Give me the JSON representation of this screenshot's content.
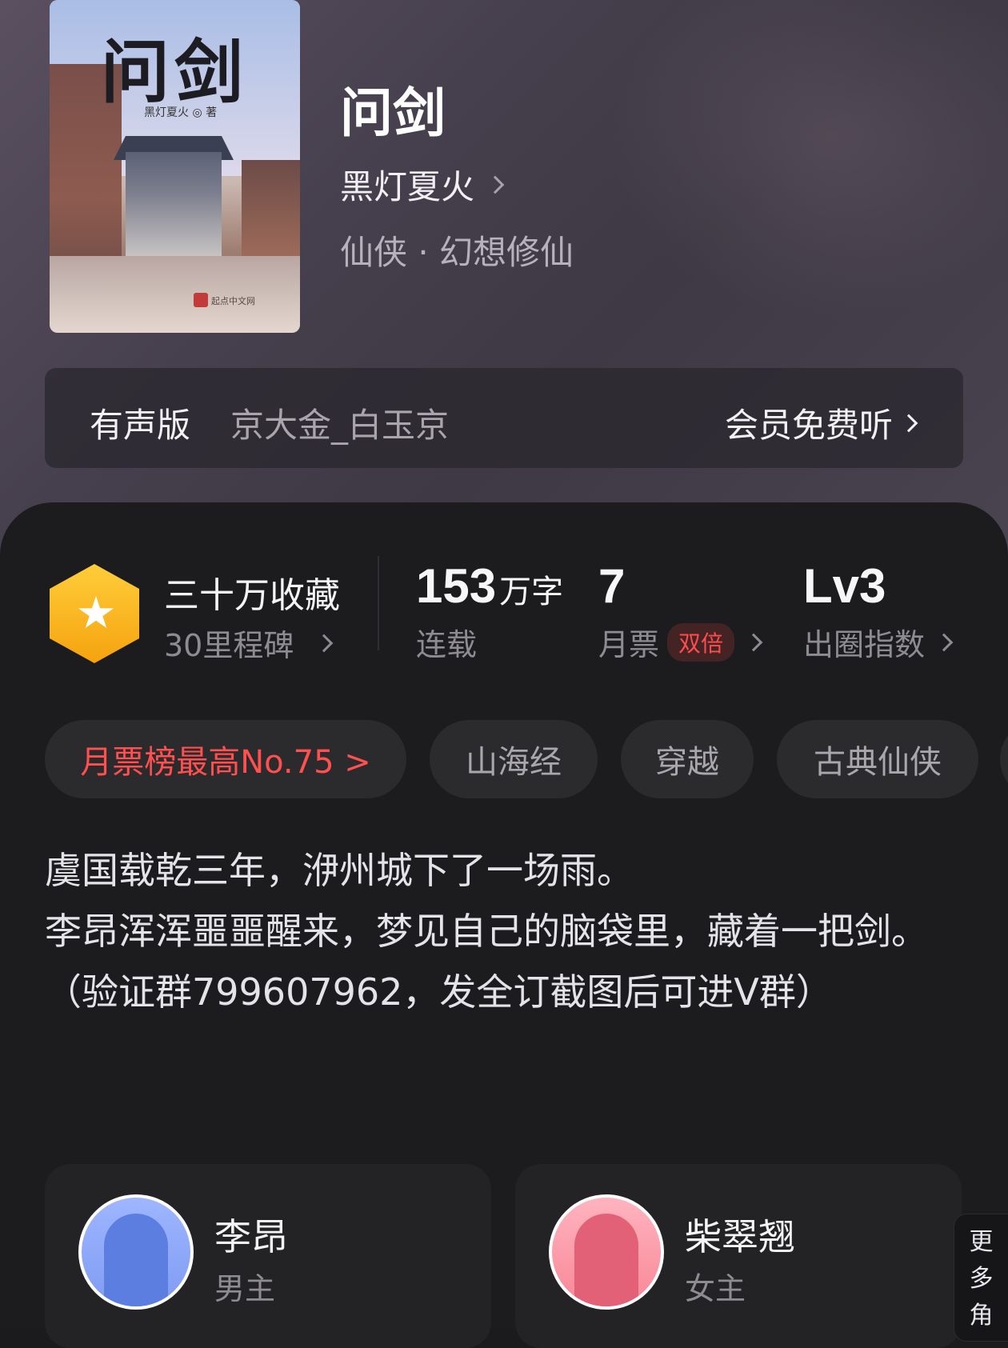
{
  "book": {
    "title": "问剑",
    "author": "黑灯夏火",
    "genre": "仙侠 · 幻想修仙",
    "cover": {
      "title": "问剑",
      "author_line": "黑灯夏火 ◎ 著",
      "publisher": "起点中文网"
    }
  },
  "audio": {
    "label": "有声版",
    "narrator": "京大金_白玉京",
    "cta": "会员免费听"
  },
  "stats": {
    "collection_title": "三十万收藏",
    "collection_sub": "30里程碑",
    "words_value": "153",
    "words_unit": "万字",
    "words_label": "连载",
    "monthly_votes_value": "7",
    "monthly_votes_label": "月票",
    "monthly_votes_tag": "双倍",
    "index_value": "Lv3",
    "index_label": "出圈指数"
  },
  "tags": [
    "月票榜最高No.75 >",
    "山海经",
    "穿越",
    "古典仙侠"
  ],
  "synopsis": "虞国载乾三年，洢州城下了一场雨。\n李昂浑浑噩噩醒来，梦见自己的脑袋里，藏着一把剑。\n（验证群799607962，发全订截图后可进V群）",
  "characters": [
    {
      "name": "李昂",
      "role": "男主"
    },
    {
      "name": "柴翠翘",
      "role": "女主"
    }
  ],
  "more_roles": [
    "更",
    "多",
    "角"
  ],
  "colors": {
    "accent_red": "#ff4f4f",
    "badge_gold": "#f5a30e",
    "panel_bg": "#1c1c1e"
  }
}
